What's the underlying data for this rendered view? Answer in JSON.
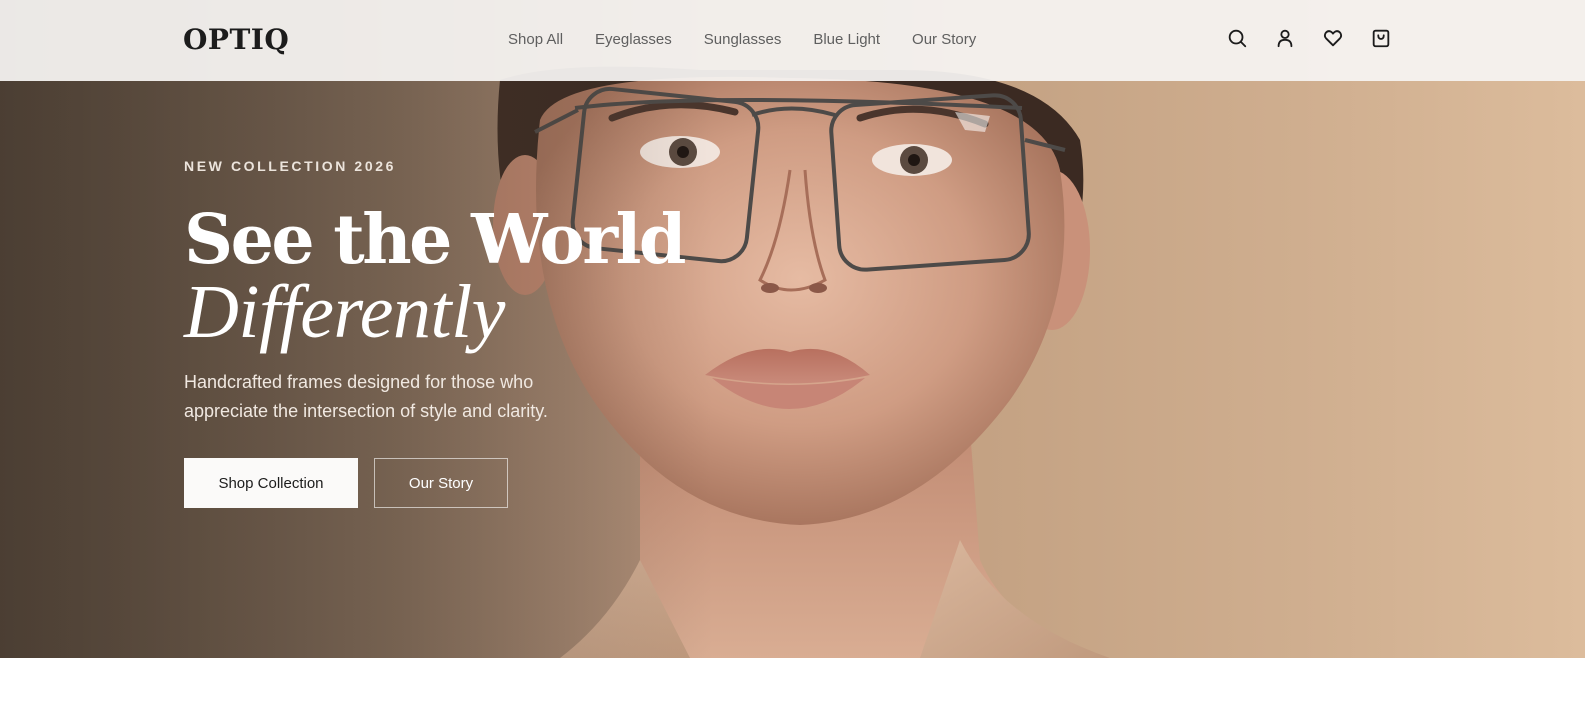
{
  "brand": {
    "logo_text": "OPTIQ"
  },
  "nav": {
    "items": [
      {
        "label": "Shop All"
      },
      {
        "label": "Eyeglasses"
      },
      {
        "label": "Sunglasses"
      },
      {
        "label": "Blue Light"
      },
      {
        "label": "Our Story"
      }
    ]
  },
  "header_icons": {
    "items": [
      {
        "icon": "search-icon"
      },
      {
        "icon": "account-icon"
      },
      {
        "icon": "heart-icon"
      },
      {
        "icon": "shopping-bag-icon"
      }
    ]
  },
  "hero": {
    "eyebrow": "NEW COLLECTION 2026",
    "headline_line1": "See the World",
    "headline_line2": "Differently",
    "subtitle": "Handcrafted frames designed for those who appreciate the intersection of style and clarity.",
    "primary_cta": "Shop Collection",
    "secondary_cta": "Our Story"
  },
  "colors": {
    "header_bg": "#f5f3f1",
    "text_dark": "#1c1c1c",
    "nav_text": "#5f5f5f",
    "hero_warm_left": "#5e5043",
    "hero_warm_right": "#dcbc9c",
    "button_primary_bg": "#fbfaf9"
  }
}
